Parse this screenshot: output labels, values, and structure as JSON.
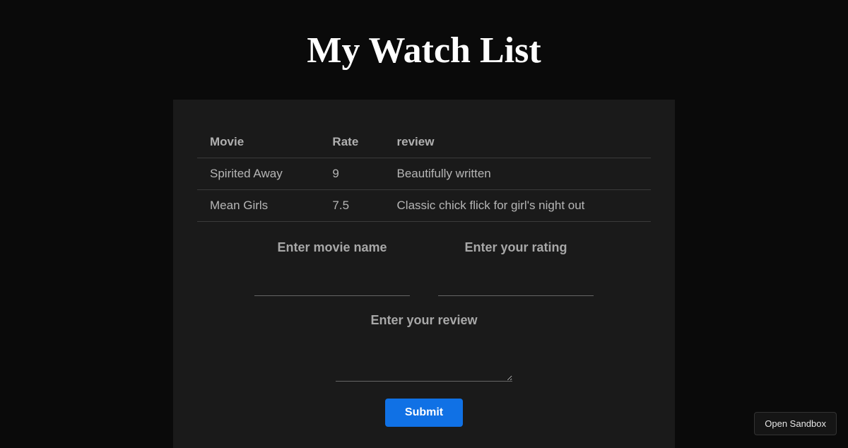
{
  "title": "My Watch List",
  "table": {
    "headers": {
      "movie": "Movie",
      "rate": "Rate",
      "review": "review"
    },
    "rows": [
      {
        "movie": "Spirited Away",
        "rate": "9",
        "review": "Beautifully written"
      },
      {
        "movie": "Mean Girls",
        "rate": "7.5",
        "review": "Classic chick flick for girl's night out"
      }
    ]
  },
  "form": {
    "movie_label": "Enter movie name",
    "rating_label": "Enter your rating",
    "review_label": "Enter your review",
    "submit_label": "Submit"
  },
  "footer": {
    "open_sandbox": "Open Sandbox"
  }
}
